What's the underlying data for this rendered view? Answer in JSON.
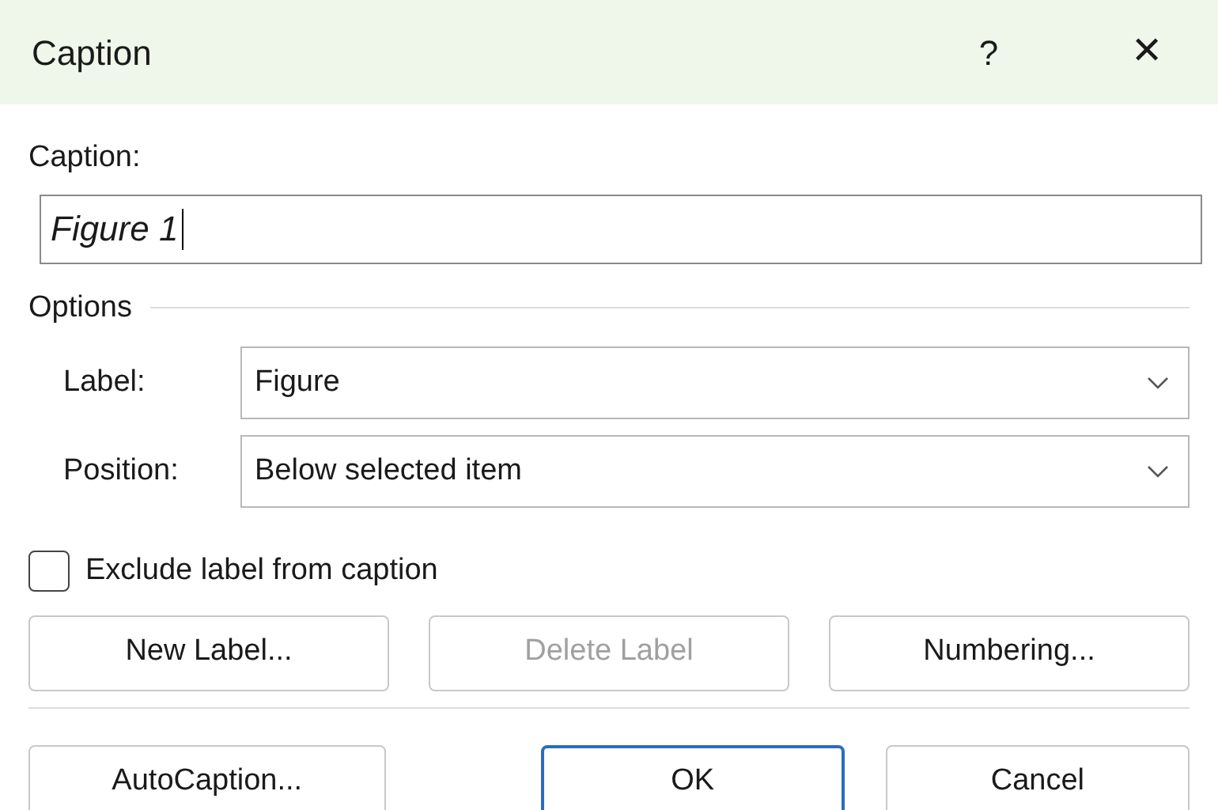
{
  "window": {
    "title": "Caption",
    "help": "?",
    "close": "✕"
  },
  "caption": {
    "label": "Caption:",
    "value": "Figure 1"
  },
  "options": {
    "heading": "Options",
    "fields": [
      {
        "label": "Label:",
        "value": "Figure"
      },
      {
        "label": "Position:",
        "value": "Below selected item"
      }
    ]
  },
  "exclude": {
    "label": "Exclude label from caption",
    "checked": false
  },
  "buttons": [
    {
      "label": "New Label...",
      "disabled": false,
      "default": false
    },
    {
      "label": "Delete Label",
      "disabled": true,
      "default": false
    },
    {
      "label": "Numbering...",
      "disabled": false,
      "default": false
    }
  ],
  "footer_buttons": [
    {
      "label": "AutoCaption...",
      "disabled": false,
      "default": false
    },
    {
      "label": "OK",
      "disabled": false,
      "default": true
    },
    {
      "label": "Cancel",
      "disabled": false,
      "default": false
    }
  ]
}
